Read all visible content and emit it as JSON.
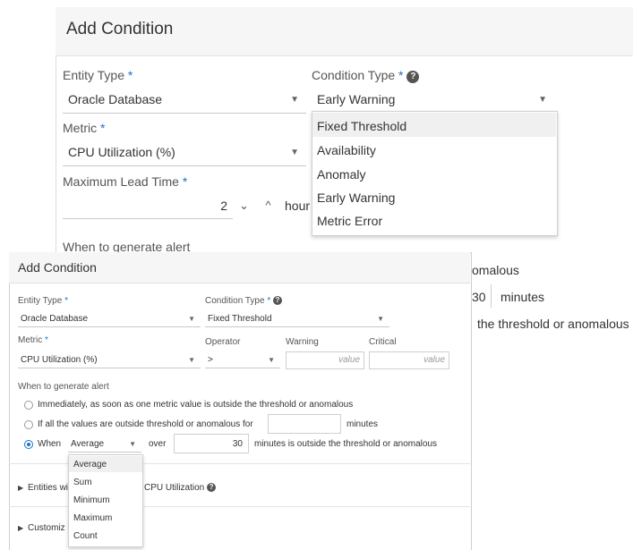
{
  "bg": {
    "title": "Add Condition",
    "entity_type_label": "Entity Type",
    "entity_type_value": "Oracle Database",
    "condition_type_label": "Condition Type",
    "condition_type_value": "Early Warning",
    "metric_label": "Metric",
    "metric_value": "CPU Utilization (%)",
    "max_lead_label": "Maximum Lead Time",
    "max_lead_value": "2",
    "max_lead_unit": "hour",
    "when_label": "When to generate alert",
    "condition_menu": [
      "Fixed Threshold",
      "Availability",
      "Anomaly",
      "Early Warning",
      "Metric Error"
    ],
    "partial_anomalous": "omalous",
    "partial_minutes_value": "30",
    "partial_minutes": "minutes",
    "partial_threshold": "the threshold or anomalous"
  },
  "fg": {
    "title": "Add Condition",
    "entity_type_label": "Entity Type",
    "entity_type_value": "Oracle Database",
    "condition_type_label": "Condition Type",
    "condition_type_value": "Fixed Threshold",
    "metric_label": "Metric",
    "metric_value": "CPU Utilization (%)",
    "operator_label": "Operator",
    "operator_value": ">",
    "warning_label": "Warning",
    "warning_placeholder": "value",
    "critical_label": "Critical",
    "critical_placeholder": "value",
    "when_label": "When to generate alert",
    "opt1": "Immediately, as soon as one metric value is outside the threshold or anomalous",
    "opt2_prefix": "If all the values are outside threshold or anomalous for",
    "opt2_suffix": "minutes",
    "opt3_prefix": "When",
    "opt3_agg_value": "Average",
    "opt3_over": "over",
    "opt3_minutes": "30",
    "opt3_suffix": "minutes is outside the threshold or anomalous",
    "agg_menu": [
      "Average",
      "Sum",
      "Minimum",
      "Maximum",
      "Count"
    ],
    "entities_prefix": "Entities wi",
    "entities_suffix": "CPU Utilization",
    "customize_prefix": "Customiz"
  },
  "colors": {
    "accent": "#1a73c9",
    "header_bg": "#f6f6f6",
    "highlight": "#f0f0f0"
  }
}
